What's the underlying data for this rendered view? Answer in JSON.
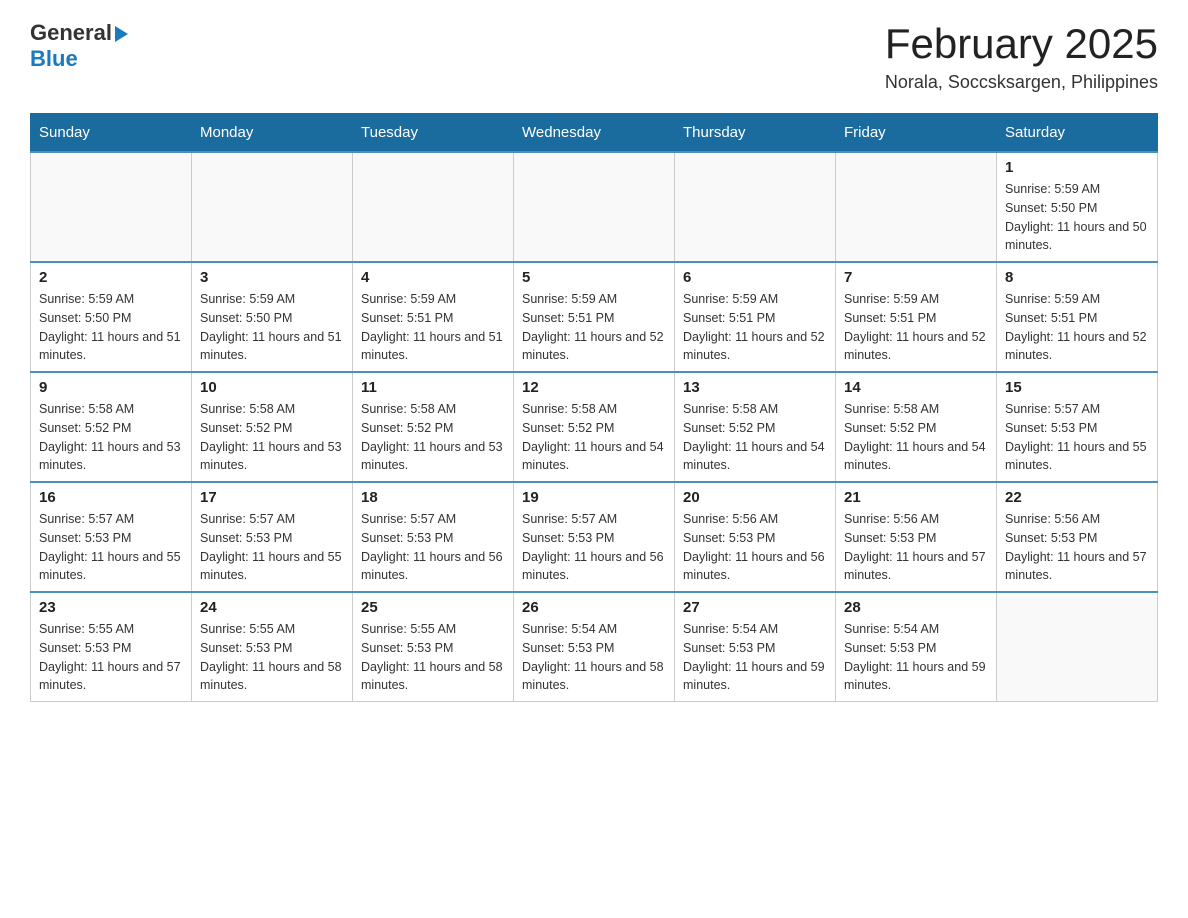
{
  "header": {
    "logo_general": "General",
    "logo_blue": "Blue",
    "month_title": "February 2025",
    "location": "Norala, Soccsksargen, Philippines"
  },
  "days_of_week": [
    "Sunday",
    "Monday",
    "Tuesday",
    "Wednesday",
    "Thursday",
    "Friday",
    "Saturday"
  ],
  "weeks": [
    [
      {
        "day": "",
        "info": ""
      },
      {
        "day": "",
        "info": ""
      },
      {
        "day": "",
        "info": ""
      },
      {
        "day": "",
        "info": ""
      },
      {
        "day": "",
        "info": ""
      },
      {
        "day": "",
        "info": ""
      },
      {
        "day": "1",
        "info": "Sunrise: 5:59 AM\nSunset: 5:50 PM\nDaylight: 11 hours and 50 minutes."
      }
    ],
    [
      {
        "day": "2",
        "info": "Sunrise: 5:59 AM\nSunset: 5:50 PM\nDaylight: 11 hours and 51 minutes."
      },
      {
        "day": "3",
        "info": "Sunrise: 5:59 AM\nSunset: 5:50 PM\nDaylight: 11 hours and 51 minutes."
      },
      {
        "day": "4",
        "info": "Sunrise: 5:59 AM\nSunset: 5:51 PM\nDaylight: 11 hours and 51 minutes."
      },
      {
        "day": "5",
        "info": "Sunrise: 5:59 AM\nSunset: 5:51 PM\nDaylight: 11 hours and 52 minutes."
      },
      {
        "day": "6",
        "info": "Sunrise: 5:59 AM\nSunset: 5:51 PM\nDaylight: 11 hours and 52 minutes."
      },
      {
        "day": "7",
        "info": "Sunrise: 5:59 AM\nSunset: 5:51 PM\nDaylight: 11 hours and 52 minutes."
      },
      {
        "day": "8",
        "info": "Sunrise: 5:59 AM\nSunset: 5:51 PM\nDaylight: 11 hours and 52 minutes."
      }
    ],
    [
      {
        "day": "9",
        "info": "Sunrise: 5:58 AM\nSunset: 5:52 PM\nDaylight: 11 hours and 53 minutes."
      },
      {
        "day": "10",
        "info": "Sunrise: 5:58 AM\nSunset: 5:52 PM\nDaylight: 11 hours and 53 minutes."
      },
      {
        "day": "11",
        "info": "Sunrise: 5:58 AM\nSunset: 5:52 PM\nDaylight: 11 hours and 53 minutes."
      },
      {
        "day": "12",
        "info": "Sunrise: 5:58 AM\nSunset: 5:52 PM\nDaylight: 11 hours and 54 minutes."
      },
      {
        "day": "13",
        "info": "Sunrise: 5:58 AM\nSunset: 5:52 PM\nDaylight: 11 hours and 54 minutes."
      },
      {
        "day": "14",
        "info": "Sunrise: 5:58 AM\nSunset: 5:52 PM\nDaylight: 11 hours and 54 minutes."
      },
      {
        "day": "15",
        "info": "Sunrise: 5:57 AM\nSunset: 5:53 PM\nDaylight: 11 hours and 55 minutes."
      }
    ],
    [
      {
        "day": "16",
        "info": "Sunrise: 5:57 AM\nSunset: 5:53 PM\nDaylight: 11 hours and 55 minutes."
      },
      {
        "day": "17",
        "info": "Sunrise: 5:57 AM\nSunset: 5:53 PM\nDaylight: 11 hours and 55 minutes."
      },
      {
        "day": "18",
        "info": "Sunrise: 5:57 AM\nSunset: 5:53 PM\nDaylight: 11 hours and 56 minutes."
      },
      {
        "day": "19",
        "info": "Sunrise: 5:57 AM\nSunset: 5:53 PM\nDaylight: 11 hours and 56 minutes."
      },
      {
        "day": "20",
        "info": "Sunrise: 5:56 AM\nSunset: 5:53 PM\nDaylight: 11 hours and 56 minutes."
      },
      {
        "day": "21",
        "info": "Sunrise: 5:56 AM\nSunset: 5:53 PM\nDaylight: 11 hours and 57 minutes."
      },
      {
        "day": "22",
        "info": "Sunrise: 5:56 AM\nSunset: 5:53 PM\nDaylight: 11 hours and 57 minutes."
      }
    ],
    [
      {
        "day": "23",
        "info": "Sunrise: 5:55 AM\nSunset: 5:53 PM\nDaylight: 11 hours and 57 minutes."
      },
      {
        "day": "24",
        "info": "Sunrise: 5:55 AM\nSunset: 5:53 PM\nDaylight: 11 hours and 58 minutes."
      },
      {
        "day": "25",
        "info": "Sunrise: 5:55 AM\nSunset: 5:53 PM\nDaylight: 11 hours and 58 minutes."
      },
      {
        "day": "26",
        "info": "Sunrise: 5:54 AM\nSunset: 5:53 PM\nDaylight: 11 hours and 58 minutes."
      },
      {
        "day": "27",
        "info": "Sunrise: 5:54 AM\nSunset: 5:53 PM\nDaylight: 11 hours and 59 minutes."
      },
      {
        "day": "28",
        "info": "Sunrise: 5:54 AM\nSunset: 5:53 PM\nDaylight: 11 hours and 59 minutes."
      },
      {
        "day": "",
        "info": ""
      }
    ]
  ]
}
